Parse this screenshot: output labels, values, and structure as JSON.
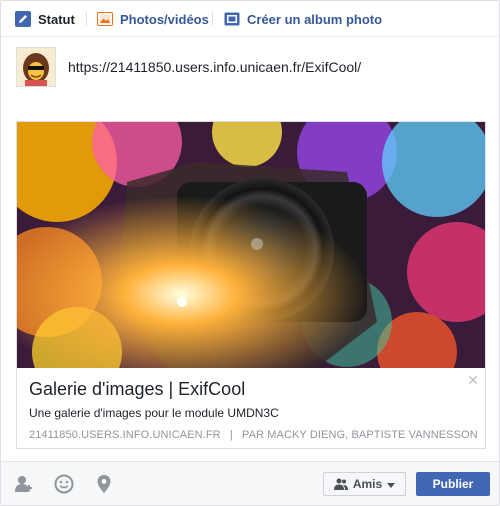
{
  "tabs": [
    {
      "label": "Statut",
      "icon": "pencil-icon"
    },
    {
      "label": "Photos/vidéos",
      "icon": "photo-icon"
    },
    {
      "label": "Créer un album photo",
      "icon": "album-icon"
    }
  ],
  "status": {
    "text": "https://21411850.users.info.unicaen.fr/ExifCool/"
  },
  "link_preview": {
    "title": "Galerie d'images | ExifCool",
    "description": "Une galerie d'images pour le module UMDN3C",
    "domain": "21411850.users.info.unicaen.fr",
    "separator": "|",
    "authors": "par Macky Dieng, Baptiste Vannesson",
    "close_symbol": "✕",
    "image_icon": "camera-lens-photo"
  },
  "footer": {
    "icons": [
      "tag-friends-icon",
      "feeling-icon",
      "location-icon"
    ],
    "audience_label": "Amis",
    "publish_label": "Publier"
  },
  "colors": {
    "brand_blue": "#4267b2",
    "link_blue": "#365899",
    "tab_icon_blue": "#4267b2",
    "tab_icon_orange": "#e9711c"
  }
}
